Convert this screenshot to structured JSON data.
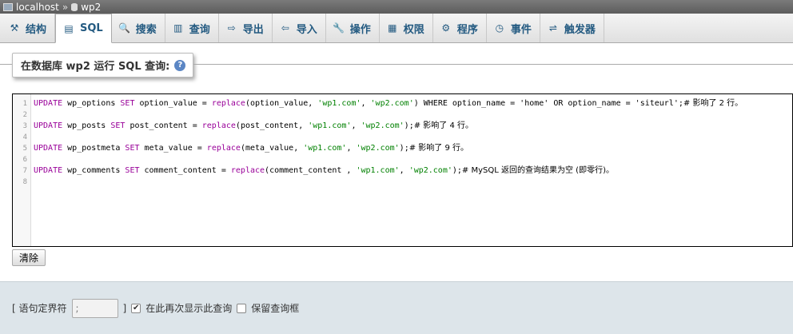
{
  "breadcrumb": {
    "server": "localhost",
    "separator": "»",
    "database": "wp2"
  },
  "tabs": [
    {
      "label": "结构",
      "icon": "structure-icon",
      "glyph": "⚒"
    },
    {
      "label": "SQL",
      "icon": "sql-icon",
      "glyph": "▤"
    },
    {
      "label": "搜索",
      "icon": "search-icon",
      "glyph": "🔍"
    },
    {
      "label": "查询",
      "icon": "query-icon",
      "glyph": "▥"
    },
    {
      "label": "导出",
      "icon": "export-icon",
      "glyph": "⇨"
    },
    {
      "label": "导入",
      "icon": "import-icon",
      "glyph": "⇦"
    },
    {
      "label": "操作",
      "icon": "wrench-icon",
      "glyph": "🔧"
    },
    {
      "label": "权限",
      "icon": "privileges-icon",
      "glyph": "▦"
    },
    {
      "label": "程序",
      "icon": "routines-icon",
      "glyph": "⚙"
    },
    {
      "label": "事件",
      "icon": "clock-icon",
      "glyph": "◷"
    },
    {
      "label": "触发器",
      "icon": "trigger-icon",
      "glyph": "⇌"
    }
  ],
  "legend": {
    "label": "在数据库 wp2 运行 SQL 查询:",
    "help": "?"
  },
  "editor": {
    "line_numbers": [
      "1",
      "2",
      "3",
      "4",
      "5",
      "6",
      "7",
      "8"
    ],
    "lines": [
      {
        "table": "wp_options",
        "column": "option_value",
        "where": "WHERE option_name = 'home' OR option_name = 'siteurl'",
        "comment": "# 影响了 2 行。"
      },
      {
        "table": "wp_posts",
        "column": "post_content",
        "where": "",
        "comment": "# 影响了 4 行。"
      },
      {
        "table": "wp_postmeta",
        "column": "meta_value",
        "where": "",
        "comment": "# 影响了 9 行。"
      },
      {
        "table": "wp_comments",
        "column": "comment_content",
        "where": "",
        "comment": "# MySQL 返回的查询结果为空 (即零行)。"
      }
    ]
  },
  "clear_button": "清除",
  "options": {
    "delimiter_label_open": "[ 语句定界符",
    "delimiter_value": ";",
    "delimiter_label_close": "]",
    "show_again_label": "在此再次显示此查询",
    "show_again_checked": true,
    "retain_box_label": "保留查询框",
    "retain_box_checked": false
  },
  "colors": {
    "tab_text": "#235a81",
    "keyword": "#990099",
    "string": "#008000",
    "number": "#0000ff"
  }
}
